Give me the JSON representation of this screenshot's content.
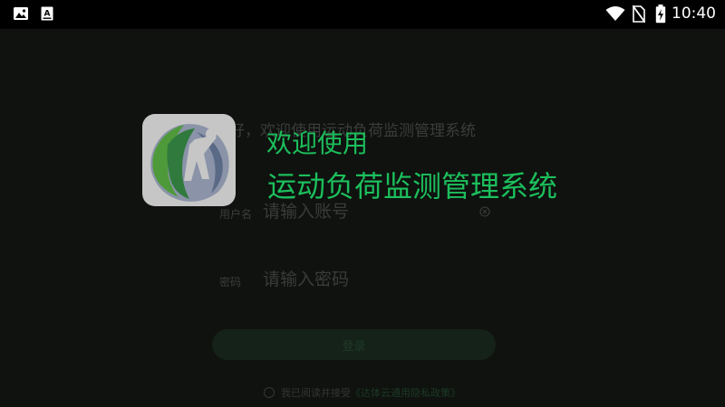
{
  "status_bar": {
    "time": "10:40",
    "icons": [
      "image-icon",
      "font-a-icon",
      "wifi-icon",
      "no-sim-icon",
      "battery-charging-icon"
    ]
  },
  "login": {
    "greeting": "您好，欢迎使用运动负荷监测管理系统",
    "username_label": "用户名",
    "username_placeholder": "请输入账号",
    "password_label": "密码",
    "password_placeholder": "请输入密码",
    "login_button": "登录",
    "agree_text": "我已阅读并接受",
    "agree_link": "《达体云通用隐私政策》"
  },
  "welcome": {
    "title": "欢迎使用",
    "subtitle": "运动负荷监测管理系统"
  },
  "colors": {
    "accent": "#1cbf5c",
    "background": "#0f120f",
    "status_bar": "#000000"
  }
}
